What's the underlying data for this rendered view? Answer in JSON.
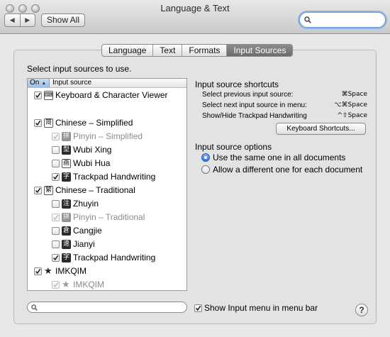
{
  "window": {
    "title": "Language & Text"
  },
  "toolbar": {
    "show_all_label": "Show All",
    "search_value": ""
  },
  "tabs": [
    {
      "label": "Language",
      "active": false
    },
    {
      "label": "Text",
      "active": false
    },
    {
      "label": "Formats",
      "active": false
    },
    {
      "label": "Input Sources",
      "active": true
    }
  ],
  "sources": {
    "heading": "Select input sources to use.",
    "col_on": "On",
    "col_source": "Input source",
    "items": [
      {
        "label": "Keyboard & Character Viewer",
        "checked": true,
        "enabled": true,
        "icon": "keyboard-viewer-icon",
        "glyph": "⌨",
        "indent": false
      },
      {
        "label": "Chinese – Simplified",
        "checked": true,
        "enabled": true,
        "icon": "chinese-simplified-icon",
        "glyph": "简",
        "indent": false
      },
      {
        "label": "Pinyin – Simplified",
        "checked": true,
        "enabled": false,
        "icon": "pinyin-icon",
        "glyph": "拼",
        "indent": true
      },
      {
        "label": "Wubi Xing",
        "checked": false,
        "enabled": true,
        "icon": "wubi-xing-icon",
        "glyph": "型",
        "indent": true
      },
      {
        "label": "Wubi Hua",
        "checked": false,
        "enabled": true,
        "icon": "wubi-hua-icon",
        "glyph": "画",
        "indent": true
      },
      {
        "label": "Trackpad Handwriting",
        "checked": true,
        "enabled": true,
        "icon": "handwriting-icon",
        "glyph": "字",
        "indent": true
      },
      {
        "label": "Chinese – Traditional",
        "checked": true,
        "enabled": true,
        "icon": "chinese-traditional-icon",
        "glyph": "繁",
        "indent": false
      },
      {
        "label": "Zhuyin",
        "checked": false,
        "enabled": true,
        "icon": "zhuyin-icon",
        "glyph": "注",
        "indent": true
      },
      {
        "label": "Pinyin – Traditional",
        "checked": true,
        "enabled": false,
        "icon": "pinyin-traditional-icon",
        "glyph": "拼",
        "indent": true
      },
      {
        "label": "Cangjie",
        "checked": false,
        "enabled": true,
        "icon": "cangjie-icon",
        "glyph": "倉",
        "indent": true
      },
      {
        "label": "Jianyi",
        "checked": false,
        "enabled": true,
        "icon": "jianyi-icon",
        "glyph": "速",
        "indent": true
      },
      {
        "label": "Trackpad Handwriting",
        "checked": true,
        "enabled": true,
        "icon": "handwriting-icon",
        "glyph": "字",
        "indent": true
      },
      {
        "label": "IMKQIM",
        "checked": true,
        "enabled": true,
        "icon": "star-icon",
        "glyph": "★",
        "indent": false
      },
      {
        "label": "IMKQIM",
        "checked": true,
        "enabled": false,
        "icon": "star-icon",
        "glyph": "★",
        "indent": true
      }
    ]
  },
  "shortcuts": {
    "title": "Input source shortcuts",
    "rows": [
      {
        "label": "Select previous input source:",
        "key": "⌘Space"
      },
      {
        "label": "Select next input source in menu:",
        "key": "⌥⌘Space"
      },
      {
        "label": "Show/Hide Trackpad Handwriting",
        "key": "^⇧Space"
      }
    ],
    "button_label": "Keyboard Shortcuts..."
  },
  "options": {
    "title": "Input source options",
    "choices": [
      {
        "label": "Use the same one in all documents",
        "selected": true
      },
      {
        "label": "Allow a different one for each document",
        "selected": false
      }
    ]
  },
  "bottom": {
    "search_value": "",
    "show_menu_label": "Show Input menu in menu bar",
    "show_menu_checked": true,
    "help_label": "?"
  }
}
